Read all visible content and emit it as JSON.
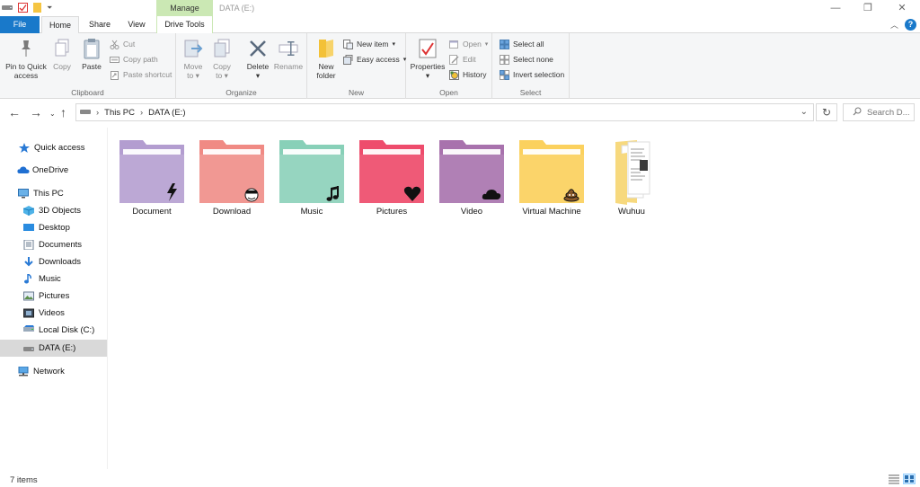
{
  "window": {
    "context_tab": "Manage",
    "title": "DATA (E:)"
  },
  "tabs": {
    "file": "File",
    "home": "Home",
    "share": "Share",
    "view": "View",
    "drive_tools": "Drive Tools"
  },
  "ribbon": {
    "clipboard": {
      "label": "Clipboard",
      "pin_line1": "Pin to Quick",
      "pin_line2": "access",
      "copy": "Copy",
      "paste": "Paste",
      "cut": "Cut",
      "copy_path": "Copy path",
      "paste_shortcut": "Paste shortcut"
    },
    "organize": {
      "label": "Organize",
      "move_to_1": "Move",
      "move_to_2": "to",
      "copy_to_1": "Copy",
      "copy_to_2": "to",
      "delete": "Delete",
      "rename": "Rename"
    },
    "new": {
      "label": "New",
      "new_folder_1": "New",
      "new_folder_2": "folder",
      "new_item": "New item",
      "easy_access": "Easy access"
    },
    "open": {
      "label": "Open",
      "properties": "Properties",
      "open": "Open",
      "edit": "Edit",
      "history": "History"
    },
    "select": {
      "label": "Select",
      "select_all": "Select all",
      "select_none": "Select none",
      "invert": "Invert selection"
    }
  },
  "address": {
    "crumbs": [
      "This PC",
      "DATA (E:)"
    ],
    "search_placeholder": "Search D..."
  },
  "nav": [
    {
      "label": "Quick access",
      "icon": "star-icon"
    },
    {
      "label": "OneDrive",
      "icon": "cloud-icon"
    },
    {
      "label": "This PC",
      "icon": "computer-icon"
    },
    {
      "label": "3D Objects",
      "icon": "cube-icon"
    },
    {
      "label": "Desktop",
      "icon": "desktop-icon"
    },
    {
      "label": "Documents",
      "icon": "documents-icon"
    },
    {
      "label": "Downloads",
      "icon": "download-icon"
    },
    {
      "label": "Music",
      "icon": "music-icon"
    },
    {
      "label": "Pictures",
      "icon": "pictures-icon"
    },
    {
      "label": "Videos",
      "icon": "videos-icon"
    },
    {
      "label": "Local Disk (C:)",
      "icon": "drive-icon"
    },
    {
      "label": "DATA (E:)",
      "icon": "drive-icon",
      "selected": true
    },
    {
      "label": "Network",
      "icon": "network-icon"
    }
  ],
  "items": [
    {
      "name": "Document",
      "color": "#b39dd0",
      "badge": "lightning-icon"
    },
    {
      "name": "Download",
      "color": "#f08a84",
      "badge": "face-icon"
    },
    {
      "name": "Music",
      "color": "#88d0b8",
      "badge": "music-note-icon"
    },
    {
      "name": "Pictures",
      "color": "#ee4c6c",
      "badge": "heart-icon"
    },
    {
      "name": "Video",
      "color": "#a872ad",
      "badge": "cloud-icon"
    },
    {
      "name": "Virtual Machine",
      "color": "#fbd15e",
      "badge": "poop-icon"
    },
    {
      "name": "Wuhuu",
      "color": "#f7d97e",
      "badge": "documents-preview"
    }
  ],
  "status": {
    "count": "7 items"
  }
}
